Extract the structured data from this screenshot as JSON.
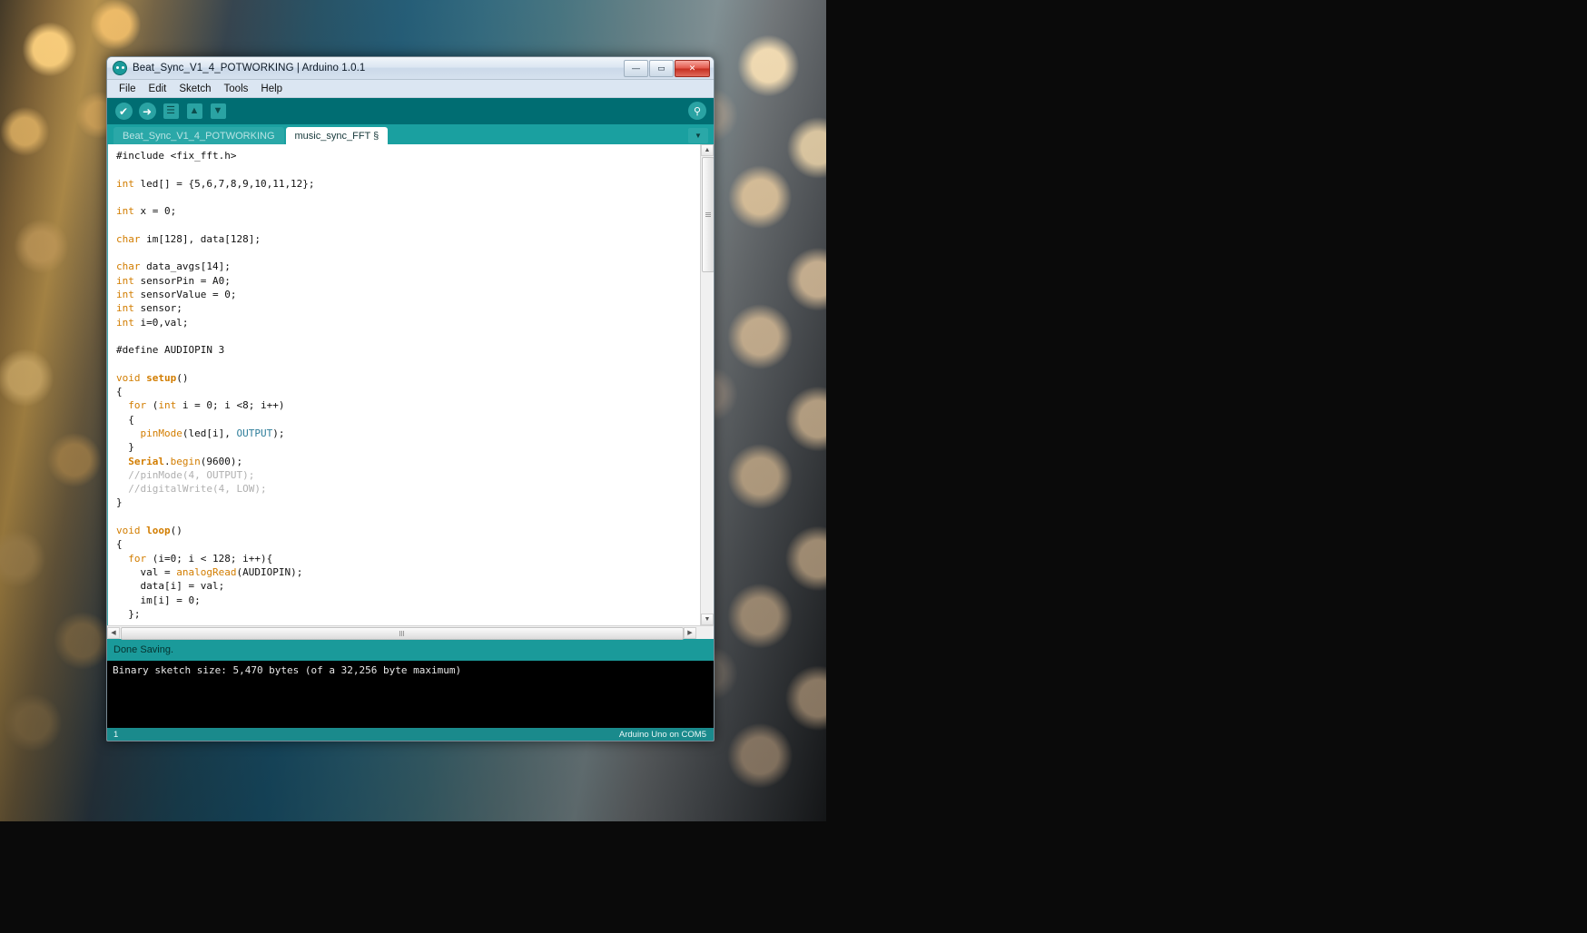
{
  "window": {
    "title": "Beat_Sync_V1_4_POTWORKING | Arduino 1.0.1",
    "logo_icon": "arduino-infinity-icon",
    "controls": {
      "minimize": "—",
      "maximize": "▭",
      "close": "✕"
    }
  },
  "menubar": {
    "items": [
      {
        "label": "File"
      },
      {
        "label": "Edit"
      },
      {
        "label": "Sketch"
      },
      {
        "label": "Tools"
      },
      {
        "label": "Help"
      }
    ]
  },
  "toolbar": {
    "buttons": [
      {
        "name": "verify-button",
        "icon": "check-icon",
        "glyph": "✔"
      },
      {
        "name": "upload-button",
        "icon": "arrow-right-icon",
        "glyph": "➜"
      },
      {
        "name": "new-button",
        "icon": "new-file-icon",
        "glyph": "☰"
      },
      {
        "name": "open-button",
        "icon": "arrow-up-icon",
        "glyph": "▲"
      },
      {
        "name": "save-button",
        "icon": "arrow-down-icon",
        "glyph": "▼"
      }
    ],
    "serial_monitor": {
      "icon": "magnifier-icon",
      "glyph": "⚲"
    }
  },
  "tabs": {
    "items": [
      {
        "label": "Beat_Sync_V1_4_POTWORKING",
        "active": false
      },
      {
        "label": "music_sync_FFT §",
        "active": true
      }
    ],
    "menu_glyph": "▼"
  },
  "editor": {
    "scrollbars": {
      "v_up": "▲",
      "v_down": "▼",
      "h_left": "◀",
      "h_right": "▶"
    },
    "lines": [
      [
        {
          "t": "#include <fix_fft.h>",
          "c": ""
        }
      ],
      [],
      [
        {
          "t": "int",
          "c": "k-type"
        },
        {
          "t": " led[] = {5,6,7,8,9,10,11,12};",
          "c": ""
        }
      ],
      [],
      [
        {
          "t": "int",
          "c": "k-type"
        },
        {
          "t": " x = 0;",
          "c": ""
        }
      ],
      [],
      [
        {
          "t": "char",
          "c": "k-type"
        },
        {
          "t": " im[128], data[128];",
          "c": ""
        }
      ],
      [],
      [
        {
          "t": "char",
          "c": "k-type"
        },
        {
          "t": " data_avgs[14];",
          "c": ""
        }
      ],
      [
        {
          "t": "int",
          "c": "k-type"
        },
        {
          "t": " sensorPin = A0;",
          "c": ""
        }
      ],
      [
        {
          "t": "int",
          "c": "k-type"
        },
        {
          "t": " sensorValue = 0;",
          "c": ""
        }
      ],
      [
        {
          "t": "int",
          "c": "k-type"
        },
        {
          "t": " sensor;",
          "c": ""
        }
      ],
      [
        {
          "t": "int",
          "c": "k-type"
        },
        {
          "t": " i=0,val;",
          "c": ""
        }
      ],
      [],
      [
        {
          "t": "#define AUDIOPIN 3",
          "c": ""
        }
      ],
      [],
      [
        {
          "t": "void",
          "c": "k-type"
        },
        {
          "t": " ",
          "c": ""
        },
        {
          "t": "setup",
          "c": "k-bold"
        },
        {
          "t": "()",
          "c": ""
        }
      ],
      [
        {
          "t": "{",
          "c": ""
        }
      ],
      [
        {
          "t": "  ",
          "c": ""
        },
        {
          "t": "for",
          "c": "k-type"
        },
        {
          "t": " (",
          "c": ""
        },
        {
          "t": "int",
          "c": "k-type"
        },
        {
          "t": " i = 0; i <8; i++)",
          "c": ""
        }
      ],
      [
        {
          "t": "  {",
          "c": ""
        }
      ],
      [
        {
          "t": "    ",
          "c": ""
        },
        {
          "t": "pinMode",
          "c": "k-fn"
        },
        {
          "t": "(led[i], ",
          "c": ""
        },
        {
          "t": "OUTPUT",
          "c": "k-const"
        },
        {
          "t": ");",
          "c": ""
        }
      ],
      [
        {
          "t": "  }",
          "c": ""
        }
      ],
      [
        {
          "t": "  ",
          "c": ""
        },
        {
          "t": "Serial",
          "c": "k-bold"
        },
        {
          "t": ".",
          "c": ""
        },
        {
          "t": "begin",
          "c": "k-fn"
        },
        {
          "t": "(9600);",
          "c": ""
        }
      ],
      [
        {
          "t": "  //pinMode(4, OUTPUT);",
          "c": "k-cmt"
        }
      ],
      [
        {
          "t": "  //digitalWrite(4, LOW);",
          "c": "k-cmt"
        }
      ],
      [
        {
          "t": "}",
          "c": ""
        }
      ],
      [],
      [
        {
          "t": "void",
          "c": "k-type"
        },
        {
          "t": " ",
          "c": ""
        },
        {
          "t": "loop",
          "c": "k-bold"
        },
        {
          "t": "()",
          "c": ""
        }
      ],
      [
        {
          "t": "{",
          "c": ""
        }
      ],
      [
        {
          "t": "  ",
          "c": ""
        },
        {
          "t": "for",
          "c": "k-type"
        },
        {
          "t": " (i=0; i < 128; i++){",
          "c": ""
        }
      ],
      [
        {
          "t": "    val = ",
          "c": ""
        },
        {
          "t": "analogRead",
          "c": "k-fn"
        },
        {
          "t": "(AUDIOPIN);",
          "c": ""
        }
      ],
      [
        {
          "t": "    data[i] = val;",
          "c": ""
        }
      ],
      [
        {
          "t": "    im[i] = 0;",
          "c": ""
        }
      ],
      [
        {
          "t": "  };",
          "c": ""
        }
      ]
    ]
  },
  "status": {
    "message": "Done Saving."
  },
  "console": {
    "output": "Binary sketch size: 5,470 bytes (of a 32,256 byte maximum)"
  },
  "bottombar": {
    "line_number": "1",
    "board_info": "Arduino Uno on COM5"
  }
}
